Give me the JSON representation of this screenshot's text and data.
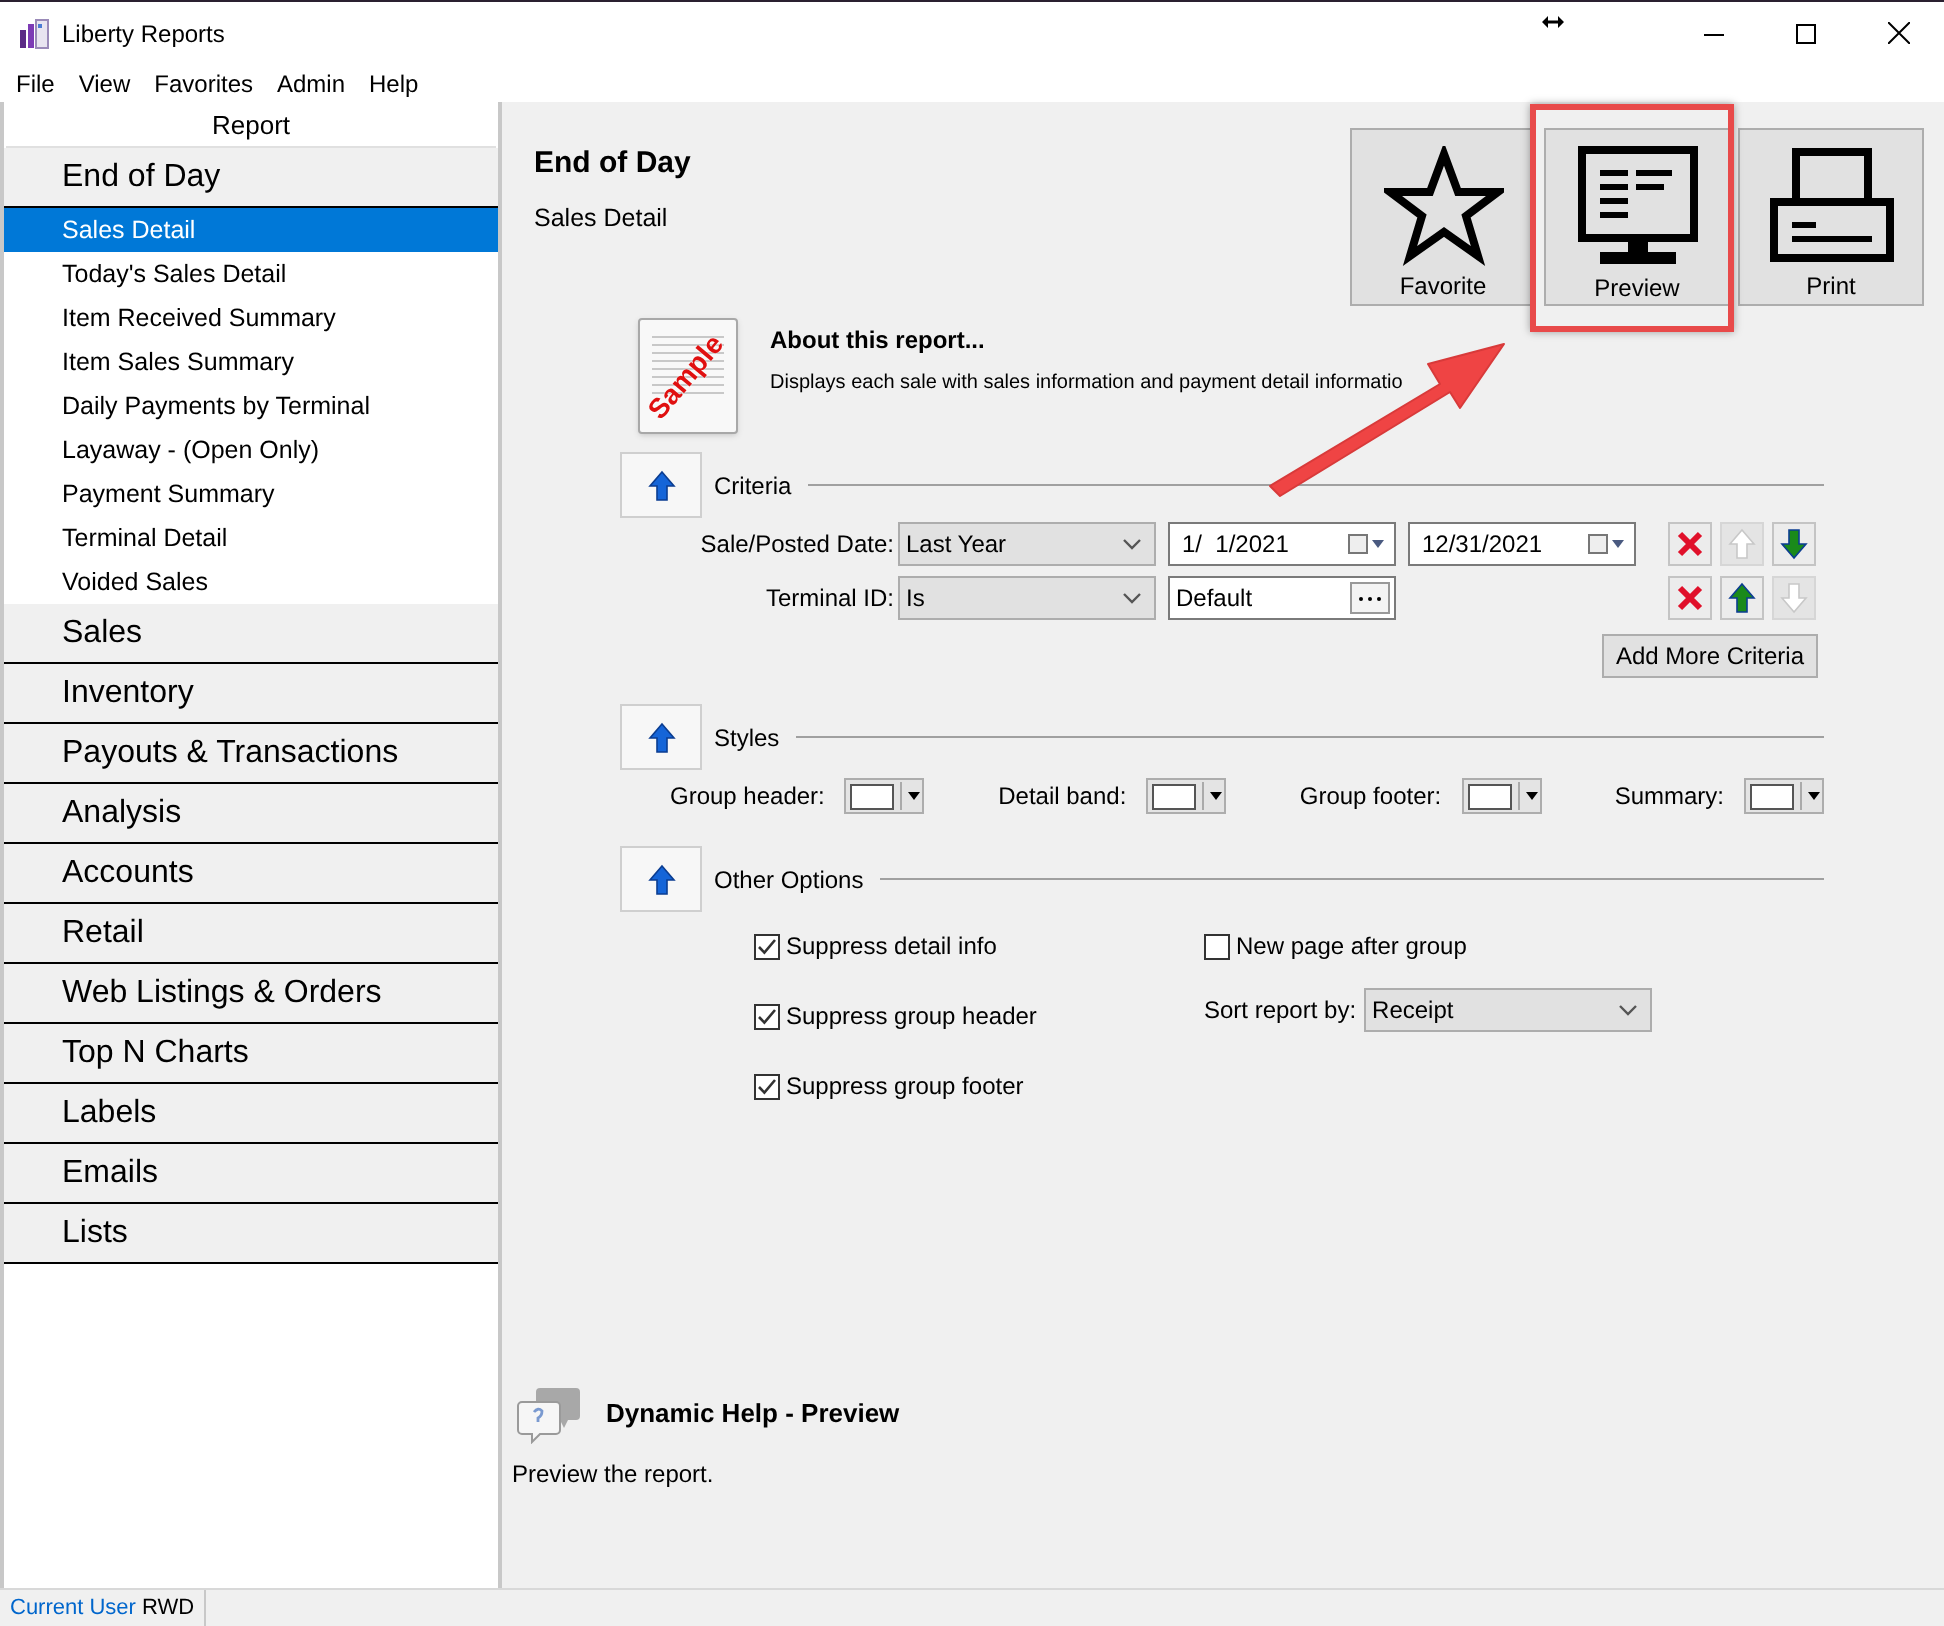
{
  "window": {
    "title": "Liberty Reports"
  },
  "menu": [
    "File",
    "View",
    "Favorites",
    "Admin",
    "Help"
  ],
  "sidebar": {
    "header": "Report",
    "categories": [
      {
        "label": "End of Day",
        "children": [
          {
            "label": "Sales Detail",
            "selected": true
          },
          {
            "label": "Today's Sales Detail",
            "selected": false
          },
          {
            "label": "Item Received Summary",
            "selected": false
          },
          {
            "label": "Item Sales Summary",
            "selected": false
          },
          {
            "label": "Daily Payments by Terminal",
            "selected": false
          },
          {
            "label": "Layaway - (Open Only)",
            "selected": false
          },
          {
            "label": "Payment Summary",
            "selected": false
          },
          {
            "label": "Terminal Detail",
            "selected": false
          },
          {
            "label": "Voided Sales",
            "selected": false
          }
        ]
      },
      {
        "label": "Sales"
      },
      {
        "label": "Inventory"
      },
      {
        "label": "Payouts & Transactions"
      },
      {
        "label": "Analysis"
      },
      {
        "label": "Accounts"
      },
      {
        "label": "Retail"
      },
      {
        "label": "Web Listings & Orders"
      },
      {
        "label": "Top N Charts"
      },
      {
        "label": "Labels"
      },
      {
        "label": "Emails"
      },
      {
        "label": "Lists"
      }
    ]
  },
  "report": {
    "title": "End of Day",
    "subtitle": "Sales Detail"
  },
  "actions": [
    {
      "kind": "favorite",
      "label": "Favorite",
      "highlighted": false
    },
    {
      "kind": "preview",
      "label": "Preview",
      "highlighted": true
    },
    {
      "kind": "print",
      "label": "Print",
      "highlighted": false
    }
  ],
  "about": {
    "stamp": "Sample",
    "title": "About this report...",
    "description": "Displays each sale with sales information and payment detail informatio"
  },
  "criteria": {
    "title": "Criteria",
    "rows": [
      {
        "label": "Sale/Posted Date:",
        "operator": "Last Year",
        "values": [
          {
            "kind": "date",
            "value": "1/  1/2021"
          },
          {
            "kind": "date",
            "value": "12/31/2021"
          }
        ],
        "up_disabled": true,
        "down_disabled": false
      },
      {
        "label": "Terminal ID:",
        "operator": "Is",
        "values": [
          {
            "kind": "lookup",
            "value": "Default"
          }
        ],
        "up_disabled": false,
        "down_disabled": true
      }
    ],
    "add_button": "Add More Criteria"
  },
  "styles": {
    "title": "Styles",
    "items": [
      "Group header:",
      "Detail band:",
      "Group footer:",
      "Summary:"
    ]
  },
  "options": {
    "title": "Other Options",
    "checkboxes": [
      {
        "label": "Suppress detail info",
        "checked": true
      },
      {
        "label": "Suppress group header",
        "checked": true
      },
      {
        "label": "Suppress group footer",
        "checked": true
      }
    ],
    "new_page": {
      "label": "New page after group",
      "checked": false
    },
    "sort": {
      "label": "Sort report by:",
      "value": "Receipt"
    }
  },
  "help": {
    "title": "Dynamic Help - Preview",
    "text": "Preview the report."
  },
  "status_bar": {
    "label": "Current User",
    "user": "RWD"
  }
}
